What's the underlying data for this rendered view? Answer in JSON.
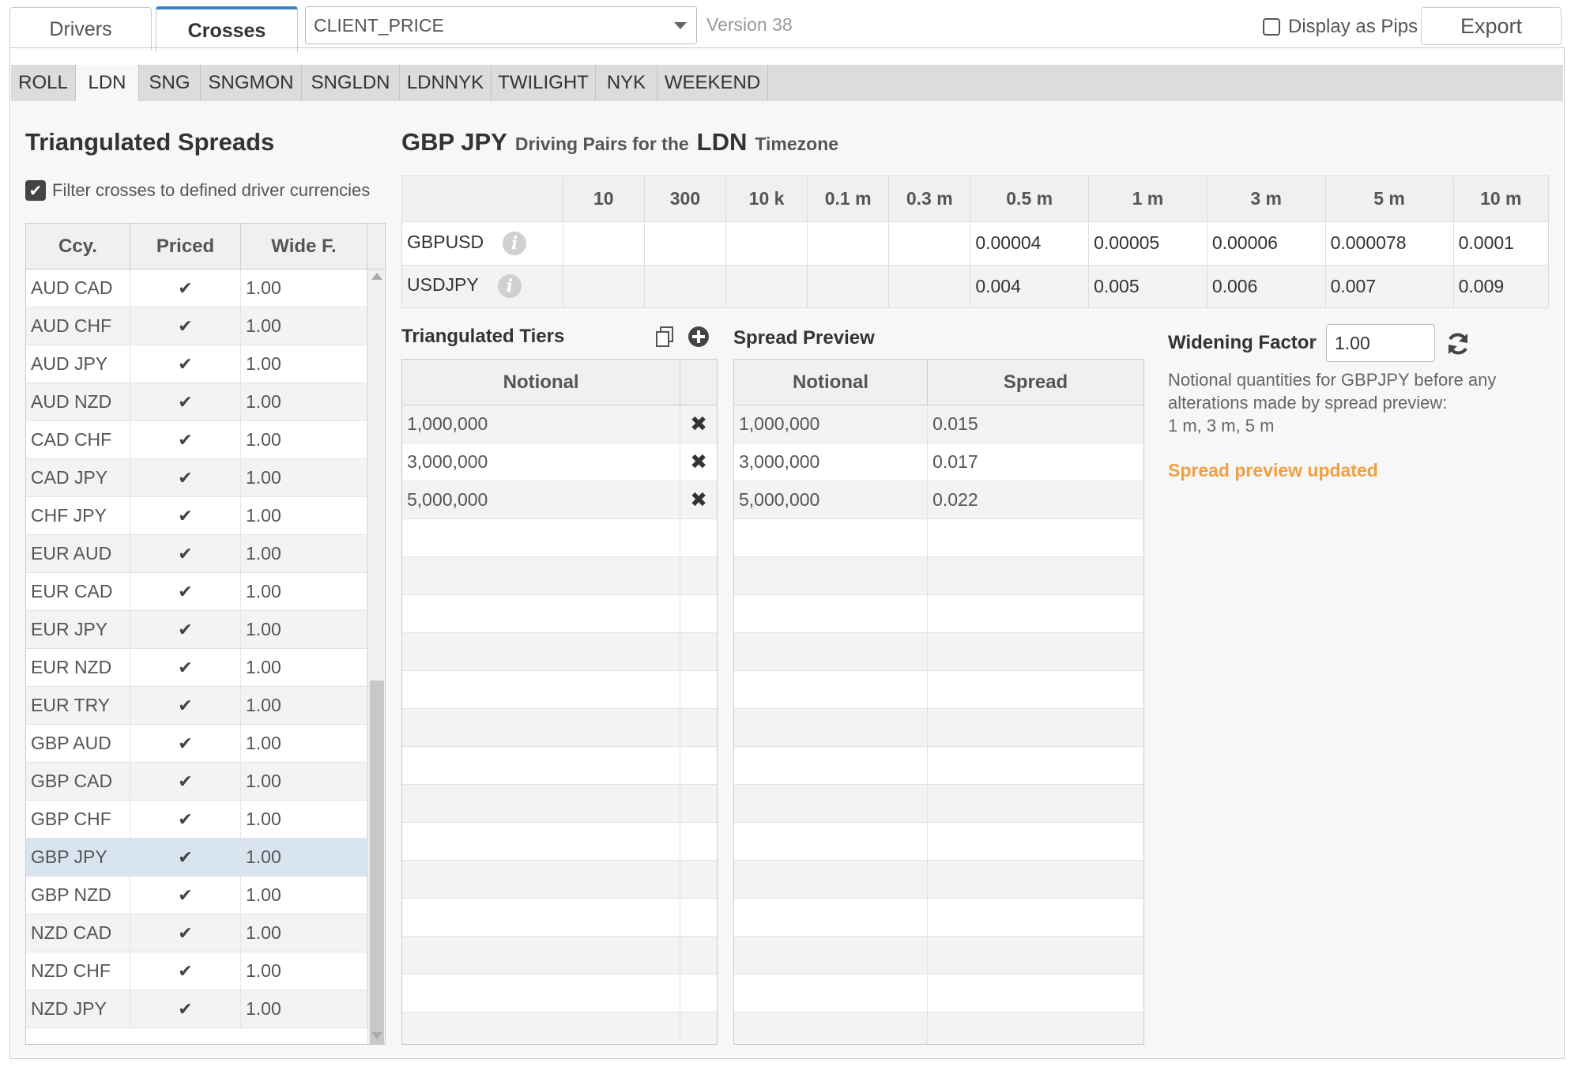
{
  "top": {
    "tabs": [
      "Drivers",
      "Crosses"
    ],
    "active_tab": "Crosses",
    "price_select": "CLIENT_PRICE",
    "version": "Version 38",
    "display_pips": "Display as Pips",
    "export": "Export"
  },
  "timezones": [
    "ROLL",
    "LDN",
    "SNG",
    "SNGMON",
    "SNGLDN",
    "LDNNYK",
    "TWILIGHT",
    "NYK",
    "WEEKEND"
  ],
  "active_timezone": "LDN",
  "left": {
    "title": "Triangulated Spreads",
    "filter_label": "Filter crosses to defined driver currencies",
    "columns": [
      "Ccy.",
      "Priced",
      "Wide F."
    ],
    "rows": [
      {
        "ccy": "AUD CAD",
        "wide": "1.00"
      },
      {
        "ccy": "AUD CHF",
        "wide": "1.00"
      },
      {
        "ccy": "AUD JPY",
        "wide": "1.00"
      },
      {
        "ccy": "AUD NZD",
        "wide": "1.00"
      },
      {
        "ccy": "CAD CHF",
        "wide": "1.00"
      },
      {
        "ccy": "CAD JPY",
        "wide": "1.00"
      },
      {
        "ccy": "CHF JPY",
        "wide": "1.00"
      },
      {
        "ccy": "EUR AUD",
        "wide": "1.00"
      },
      {
        "ccy": "EUR CAD",
        "wide": "1.00"
      },
      {
        "ccy": "EUR JPY",
        "wide": "1.00"
      },
      {
        "ccy": "EUR NZD",
        "wide": "1.00"
      },
      {
        "ccy": "EUR TRY",
        "wide": "1.00"
      },
      {
        "ccy": "GBP AUD",
        "wide": "1.00"
      },
      {
        "ccy": "GBP CAD",
        "wide": "1.00"
      },
      {
        "ccy": "GBP CHF",
        "wide": "1.00"
      },
      {
        "ccy": "GBP JPY",
        "wide": "1.00"
      },
      {
        "ccy": "GBP NZD",
        "wide": "1.00"
      },
      {
        "ccy": "NZD CAD",
        "wide": "1.00"
      },
      {
        "ccy": "NZD CHF",
        "wide": "1.00"
      },
      {
        "ccy": "NZD JPY",
        "wide": "1.00"
      }
    ],
    "selected_ccy": "GBP JPY"
  },
  "driving": {
    "pair": "GBP JPY",
    "mid_text": "Driving Pairs for the",
    "timezone": "LDN",
    "suffix": "Timezone",
    "columns": [
      "10",
      "300",
      "10 k",
      "0.1 m",
      "0.3 m",
      "0.5 m",
      "1 m",
      "3 m",
      "5 m",
      "10 m"
    ],
    "rows": [
      {
        "name": "GBPUSD",
        "values": [
          "",
          "",
          "",
          "",
          "",
          "0.00004",
          "0.00005",
          "0.00006",
          "0.000078",
          "0.0001"
        ]
      },
      {
        "name": "USDJPY",
        "values": [
          "",
          "",
          "",
          "",
          "",
          "0.004",
          "0.005",
          "0.006",
          "0.007",
          "0.009"
        ]
      }
    ]
  },
  "tiers": {
    "title": "Triangulated Tiers",
    "header": "Notional",
    "rows": [
      "1,000,000",
      "3,000,000",
      "5,000,000"
    ],
    "empty_rows": 14
  },
  "preview": {
    "title": "Spread Preview",
    "headers": [
      "Notional",
      "Spread"
    ],
    "rows": [
      {
        "notional": "1,000,000",
        "spread": "0.015"
      },
      {
        "notional": "3,000,000",
        "spread": "0.017"
      },
      {
        "notional": "5,000,000",
        "spread": "0.022"
      }
    ]
  },
  "widening": {
    "label": "Widening Factor",
    "value": "1.00",
    "desc": "Notional quantities for GBPJPY before any alterations made by spread preview:",
    "quantities": "1 m, 3 m, 5 m",
    "status": "Spread preview updated",
    "status_color": "#f0a040"
  },
  "colors": {
    "accent": "#3d82c4",
    "selected_row": "#d9e4f1"
  }
}
